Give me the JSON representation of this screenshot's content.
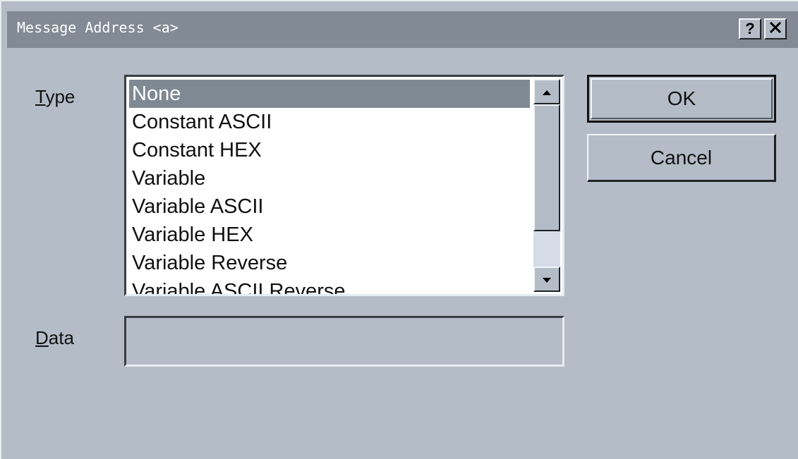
{
  "window": {
    "title": "Message Address <a>",
    "help_button": "?",
    "close_button": "✕"
  },
  "type_field": {
    "label_mnemonic": "T",
    "label_rest": "ype",
    "selected_index": 0,
    "options": [
      "None",
      "Constant ASCII",
      "Constant HEX",
      "Variable",
      "Variable ASCII",
      "Variable HEX",
      "Variable Reverse",
      "Variable ASCII Reverse"
    ],
    "scroll_position": 0.0
  },
  "data_field": {
    "label_mnemonic": "D",
    "label_rest": "ata",
    "value": ""
  },
  "buttons": {
    "ok": "OK",
    "cancel": "Cancel"
  },
  "colors": {
    "dialog_background": "#b3bcc7",
    "titlebar": "#818a95",
    "selection": "#7f8994"
  },
  "icons": {
    "scroll_up": "triangle-up-icon",
    "scroll_down": "triangle-down-icon"
  }
}
